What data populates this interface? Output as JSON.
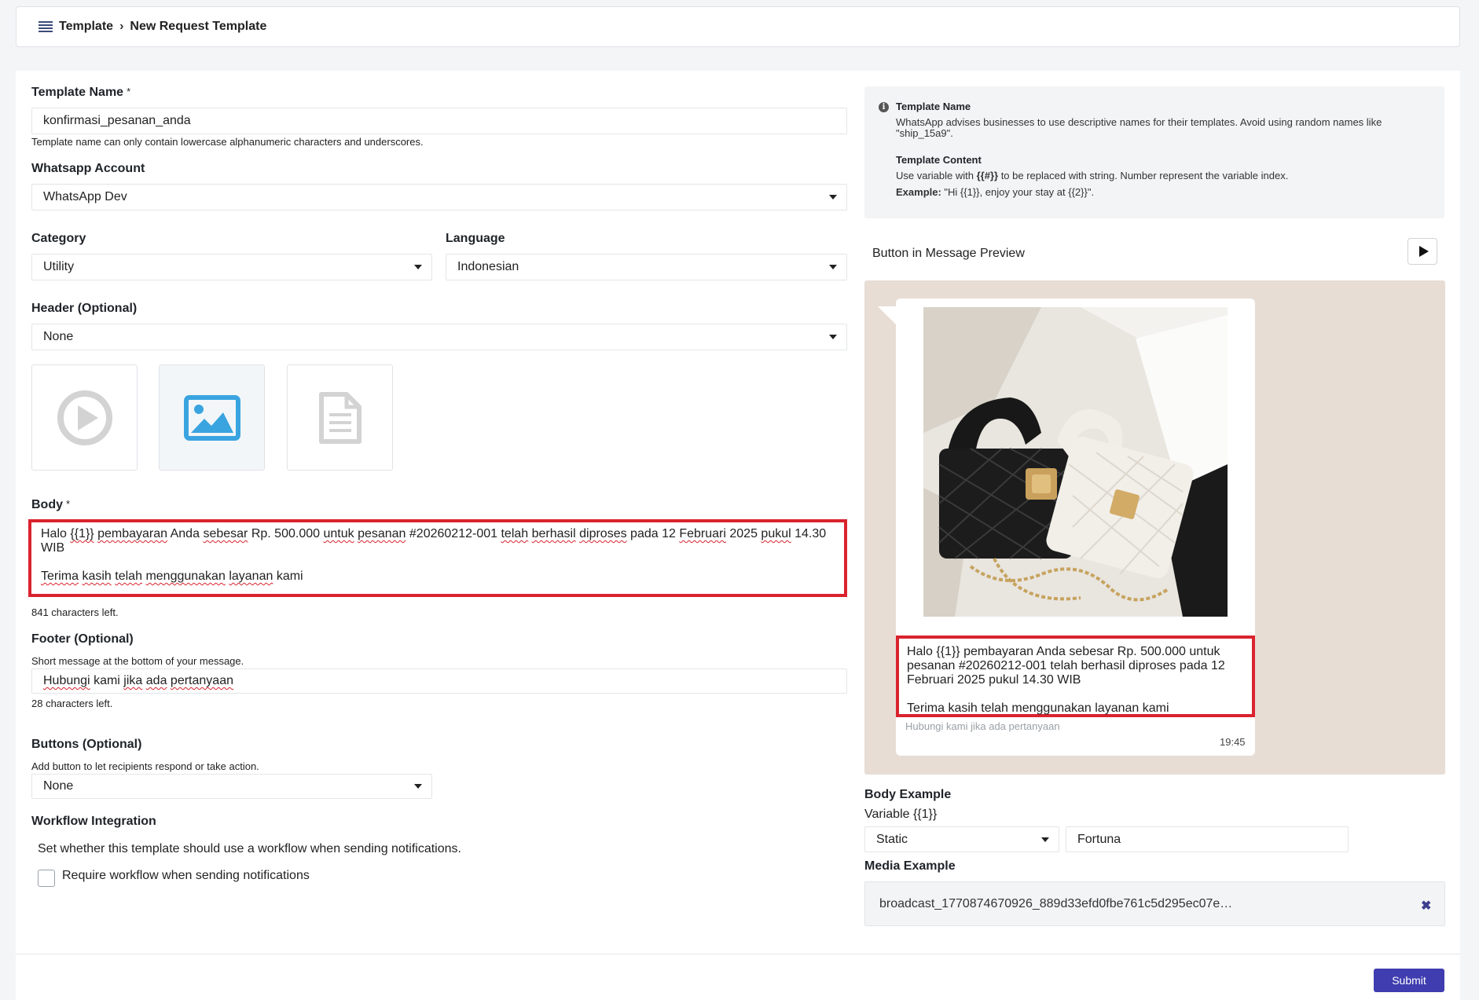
{
  "breadcrumb": {
    "parent": "Template",
    "current": "New Request Template"
  },
  "form": {
    "template_name": {
      "label": "Template Name",
      "required_mark": "*",
      "value": "konfirmasi_pesanan_anda",
      "hint": "Template name can only contain lowercase alphanumeric characters and underscores."
    },
    "whatsapp_account": {
      "label": "Whatsapp Account",
      "value": "WhatsApp Dev"
    },
    "category": {
      "label": "Category",
      "value": "Utility"
    },
    "language": {
      "label": "Language",
      "value": "Indonesian"
    },
    "header": {
      "label": "Header (Optional)",
      "value": "None",
      "media_types": [
        "video",
        "image",
        "document"
      ],
      "selected_media": "image"
    },
    "body": {
      "label": "Body",
      "required_mark": "*",
      "line1_words": [
        "Halo",
        "{{1}}",
        "pembayaran",
        "Anda",
        "sebesar",
        "Rp.",
        "500.000",
        "untuk",
        "pesanan",
        "#20260212-001",
        "telah",
        "berhasil",
        "diproses",
        "pada",
        "12",
        "Februari",
        "2025",
        "pukul",
        "14.30"
      ],
      "line2": "WIB",
      "line3_words": [
        "Terima",
        "kasih",
        "telah",
        "menggunakan",
        "layanan",
        "kami"
      ],
      "chars_left": "841 characters left."
    },
    "footer": {
      "label": "Footer (Optional)",
      "hint": "Short message at the bottom of your message.",
      "words": [
        "Hubungi",
        "kami",
        "jika",
        "ada",
        "pertanyaan"
      ],
      "chars_left": "28 characters left."
    },
    "buttons": {
      "label": "Buttons (Optional)",
      "hint": "Add button to let recipients respond or take action.",
      "value": "None"
    },
    "workflow": {
      "label": "Workflow Integration",
      "description": "Set whether this template should use a workflow when sending notifications.",
      "checkbox_label": "Require workflow when sending notifications",
      "checked": false
    }
  },
  "info": {
    "name_title": "Template Name",
    "name_text": "WhatsApp advises businesses to use descriptive names for their templates. Avoid using random names like \"ship_15a9\".",
    "content_title": "Template Content",
    "content_text_pre": "Use variable with ",
    "content_var": "{{#}}",
    "content_text_post": " to be replaced with string. Number represent the variable index.",
    "example_label": "Example:",
    "example_text": " \"Hi {{1}}, enjoy your stay at {{2}}\"."
  },
  "preview": {
    "label": "Button in Message Preview",
    "message_line1": "Halo {{1}} pembayaran Anda sebesar Rp. 500.000 untuk",
    "message_line2": "pesanan #20260212-001 telah berhasil diproses pada 12",
    "message_line3": "Februari 2025 pukul 14.30 WIB",
    "message_line4": "Terima kasih telah menggunakan layanan kami",
    "footer": "Hubungi kami jika ada pertanyaan",
    "time": "19:45"
  },
  "body_example": {
    "label": "Body Example",
    "variable_label": "Variable {{1}}",
    "type_value": "Static",
    "value": "Fortuna"
  },
  "media_example": {
    "label": "Media Example",
    "filename": "broadcast_1770874670926_889d33efd0fbe761c5d295ec07e…"
  },
  "actions": {
    "submit": "Submit"
  },
  "colors": {
    "primary": "#3f3db0",
    "highlight": "#d9232e",
    "chat_bg": "#e7ddd5"
  }
}
